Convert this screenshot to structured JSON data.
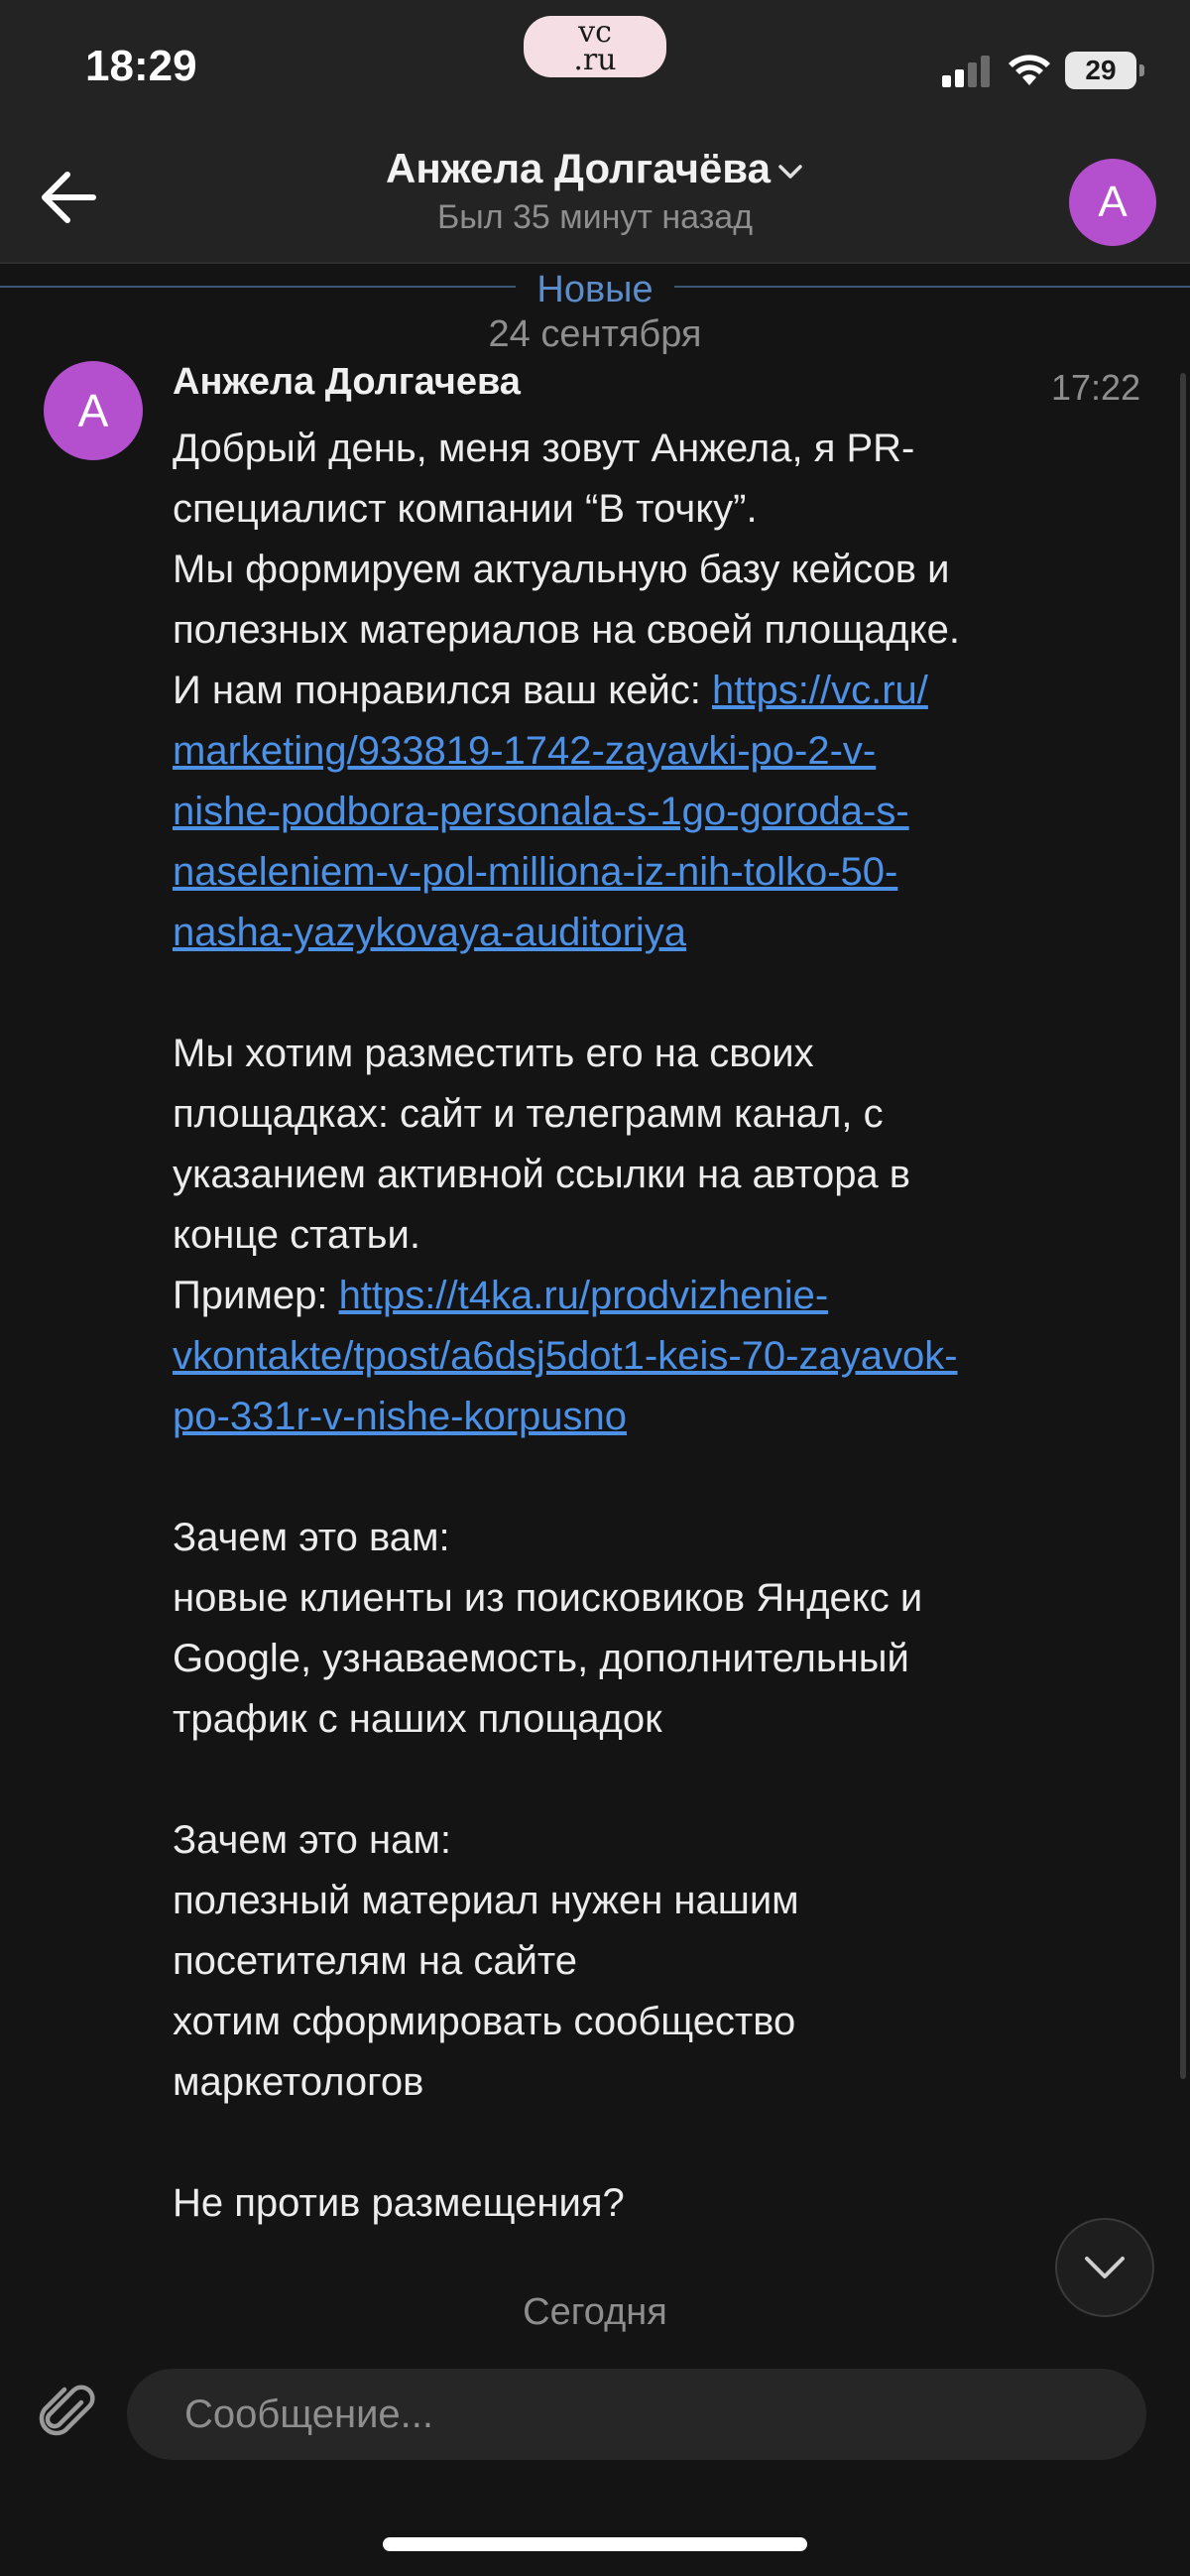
{
  "status_bar": {
    "time": "18:29",
    "logo_line1": "vc",
    "logo_line2": ".ru",
    "battery": "29"
  },
  "header": {
    "title": "Анжела Долгачёва",
    "subtitle": "Был 35 минут назад",
    "avatar_letter": "А"
  },
  "chat": {
    "new_label": "Новые",
    "date_label": "24 сентября",
    "today_label": "Сегодня",
    "message": {
      "avatar_letter": "А",
      "author": "Анжела Долгачева",
      "time": "17:22",
      "p1": "Добрый день, меня зовут Анжела, я PR-\nспециалист компании “В точку”.\nМы формируем актуальную базу кейсов и\nполезных материалов на своей площадке.\nИ нам понравился ваш кейс: ",
      "link1": "https://vc.ru/marketing/933819-1742-zayavki-po-2-v-nishe-podbora-personala-s-1go-goroda-s-naseleniem-v-pol-milliona-iz-nih-tolko-50-nasha-yazykovaya-auditoriya",
      "p2": "Мы хотим разместить его на своих\nплощадках: сайт и телеграмм канал, с\nуказанием активной ссылки на автора в\nконце статьи.\nПример: ",
      "link2": "https://t4ka.ru/prodvizhenie-vkontakte/tpost/a6dsj5dot1-keis-70-zayavok-po-331r-v-nishe-korpusno",
      "p3": "Зачем это вам:\nновые клиенты из поисковиков Яндекс и\nGoogle, узнаваемость, дополнительный\nтрафик с наших площадок",
      "p4": "Зачем это нам:\nполезный материал нужен нашим\nпосетителям на сайте\nхотим сформировать сообщество\nмаркетологов",
      "p5": "Не против размещения?"
    }
  },
  "composer": {
    "placeholder": "Сообщение..."
  },
  "colors": {
    "background": "#141414",
    "bar": "#232323",
    "avatar": "#b44fcd",
    "link": "#4d91e6",
    "new_divider": "#5c8cc9"
  }
}
